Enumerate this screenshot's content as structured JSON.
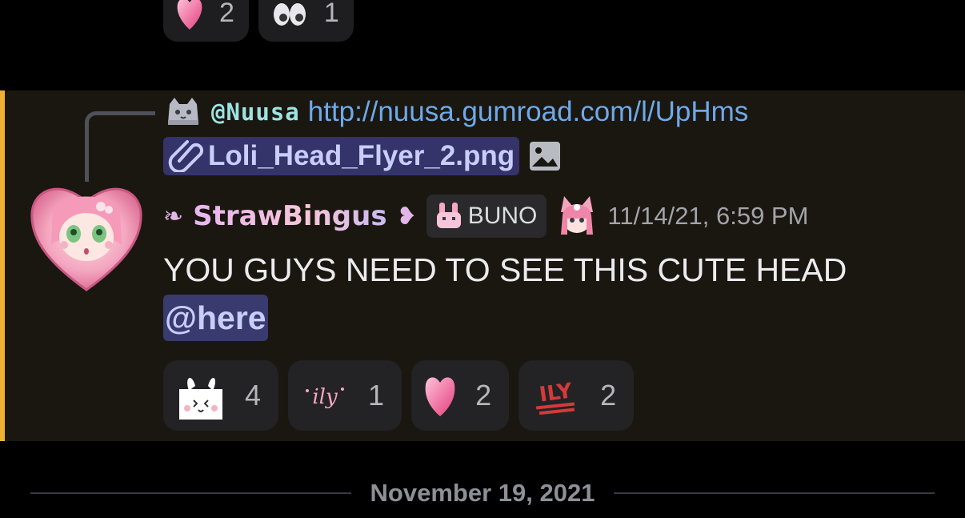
{
  "previous_reactions": [
    {
      "emoji": "pink-heart-emoji",
      "count": "2"
    },
    {
      "emoji": "eyes-emoji",
      "count": "1"
    }
  ],
  "reply": {
    "author": "@Nuusa",
    "text": "http://nuusa.gumroad.com/l/UpHms",
    "attachment": "Loli_Head_Flyer_2.png"
  },
  "message": {
    "username": "StrawBingus",
    "tag": "BUNO",
    "timestamp": "11/14/21, 6:59 PM",
    "text": "YOU GUYS NEED TO SEE THIS CUTE HEAD",
    "mention": "@here"
  },
  "reactions": [
    {
      "emoji": "bunny-emoji",
      "count": "4"
    },
    {
      "emoji": "ily-emoji",
      "count": "1"
    },
    {
      "emoji": "pink-heart-emoji",
      "count": "2"
    },
    {
      "emoji": "ily-red-emoji",
      "count": "2"
    }
  ],
  "date_divider": "November 19, 2021",
  "colors": {
    "highlight_bar": "#f0b132",
    "link": "#6fa9e8",
    "mention_bg": "#393a6e"
  }
}
